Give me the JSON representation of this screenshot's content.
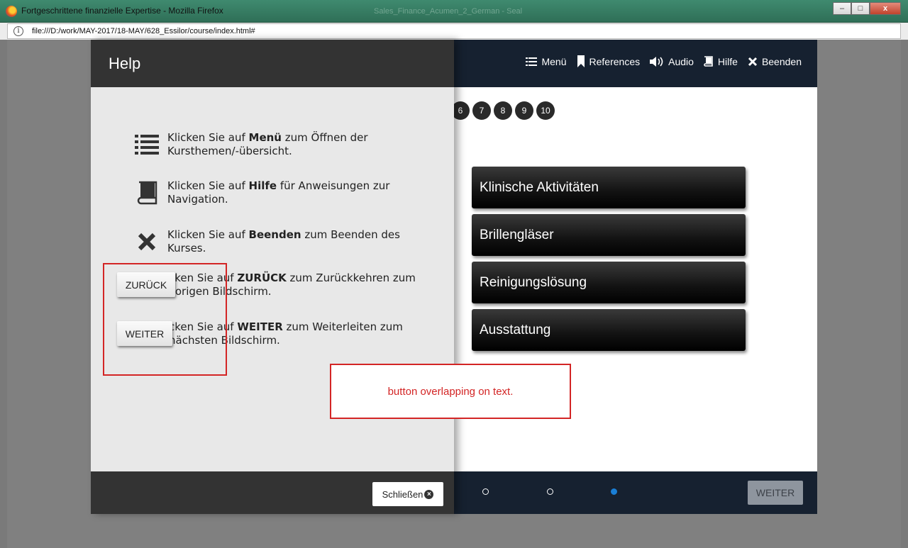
{
  "window": {
    "title": "Fortgeschrittene finanzielle Expertise - Mozilla Firefox",
    "ghost_title": "Sales_Finance_Acumen_2_German - Seal",
    "url": "file:///D:/work/MAY-2017/18-MAY/628_Essilor/course/index.html#",
    "minimize": "–",
    "maximize": "□",
    "close": "x"
  },
  "header_nav": [
    {
      "label": "Menü",
      "icon": "menu-icon"
    },
    {
      "label": "References",
      "icon": "bookmark-icon"
    },
    {
      "label": "Audio",
      "icon": "speaker-icon"
    },
    {
      "label": "Hilfe",
      "icon": "book-icon"
    },
    {
      "label": "Beenden",
      "icon": "close-icon"
    }
  ],
  "pager": [
    "6",
    "7",
    "8",
    "9",
    "10"
  ],
  "options": [
    "Klinische Aktivitäten",
    "Brillengläser",
    "Reinigungslösung",
    "Ausstattung"
  ],
  "footer": {
    "next_label": "WEITER",
    "dots_total": 3,
    "active_dot": 3
  },
  "help": {
    "title": "Help",
    "rows": [
      {
        "icon": "list-icon",
        "pre": "Klicken Sie auf ",
        "bold": "Menü",
        "post": " zum Öffnen der Kursthemen/-übersicht."
      },
      {
        "icon": "book-icon",
        "pre": "Klicken Sie auf ",
        "bold": "Hilfe",
        "post": " für Anweisungen zur Navigation."
      },
      {
        "icon": "close-icon",
        "pre": "Klicken Sie auf ",
        "bold": "Beenden",
        "post": " zum Beenden des Kurses."
      },
      {
        "icon": "none",
        "pre": "cken Sie auf ",
        "bold": "ZURÜCK",
        "post": " zum Zurückkehren zum vorigen Bildschirm."
      },
      {
        "icon": "none",
        "pre": "cken Sie auf ",
        "bold": "WEITER",
        "post": " zum Weiterleiten zum nächsten Bildschirm."
      }
    ],
    "back_button": "ZURÜCK",
    "next_button": "WEITER",
    "close_button": "Schließen"
  },
  "annotation": {
    "text": "button overlapping on text.",
    "color": "#d32525"
  }
}
